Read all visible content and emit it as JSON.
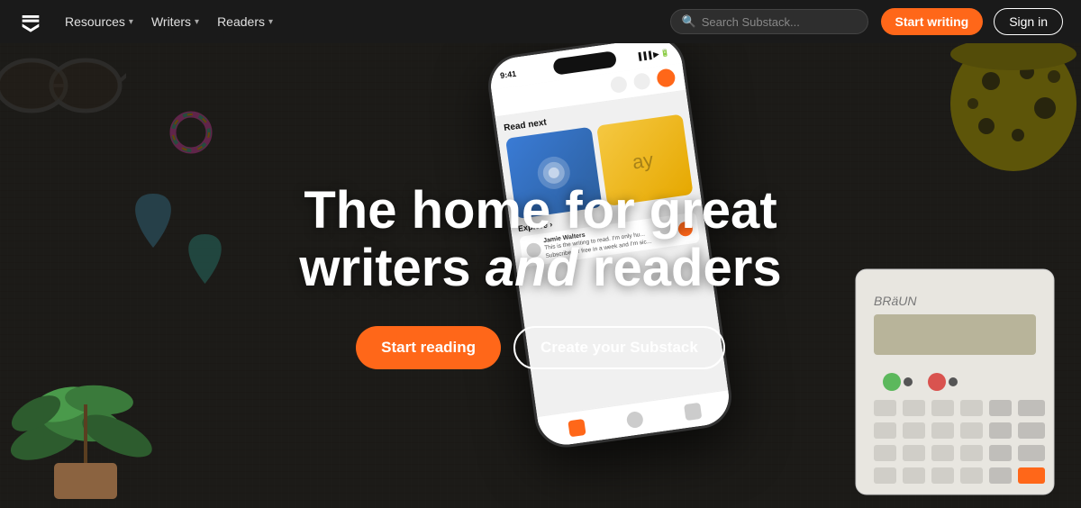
{
  "nav": {
    "logo_label": "Substack",
    "items": [
      {
        "id": "resources",
        "label": "Resources"
      },
      {
        "id": "writers",
        "label": "Writers"
      },
      {
        "id": "readers",
        "label": "Readers"
      }
    ],
    "search_placeholder": "Search Substack...",
    "start_writing_label": "Start writing",
    "sign_in_label": "Sign in"
  },
  "hero": {
    "heading_line1": "The home for great",
    "heading_line2": "writers ",
    "heading_em": "and",
    "heading_line3": " readers",
    "start_reading_label": "Start reading",
    "create_substack_label": "Create your Substack"
  },
  "phone": {
    "status_time": "9:41",
    "read_next_label": "Read next",
    "explore_label": "Explore ›",
    "list_item_name": "Jamie Walters",
    "list_item_text": "This is the writing to read. I'm only hu...\nSubscribe for free in a week and I'm sic..."
  }
}
